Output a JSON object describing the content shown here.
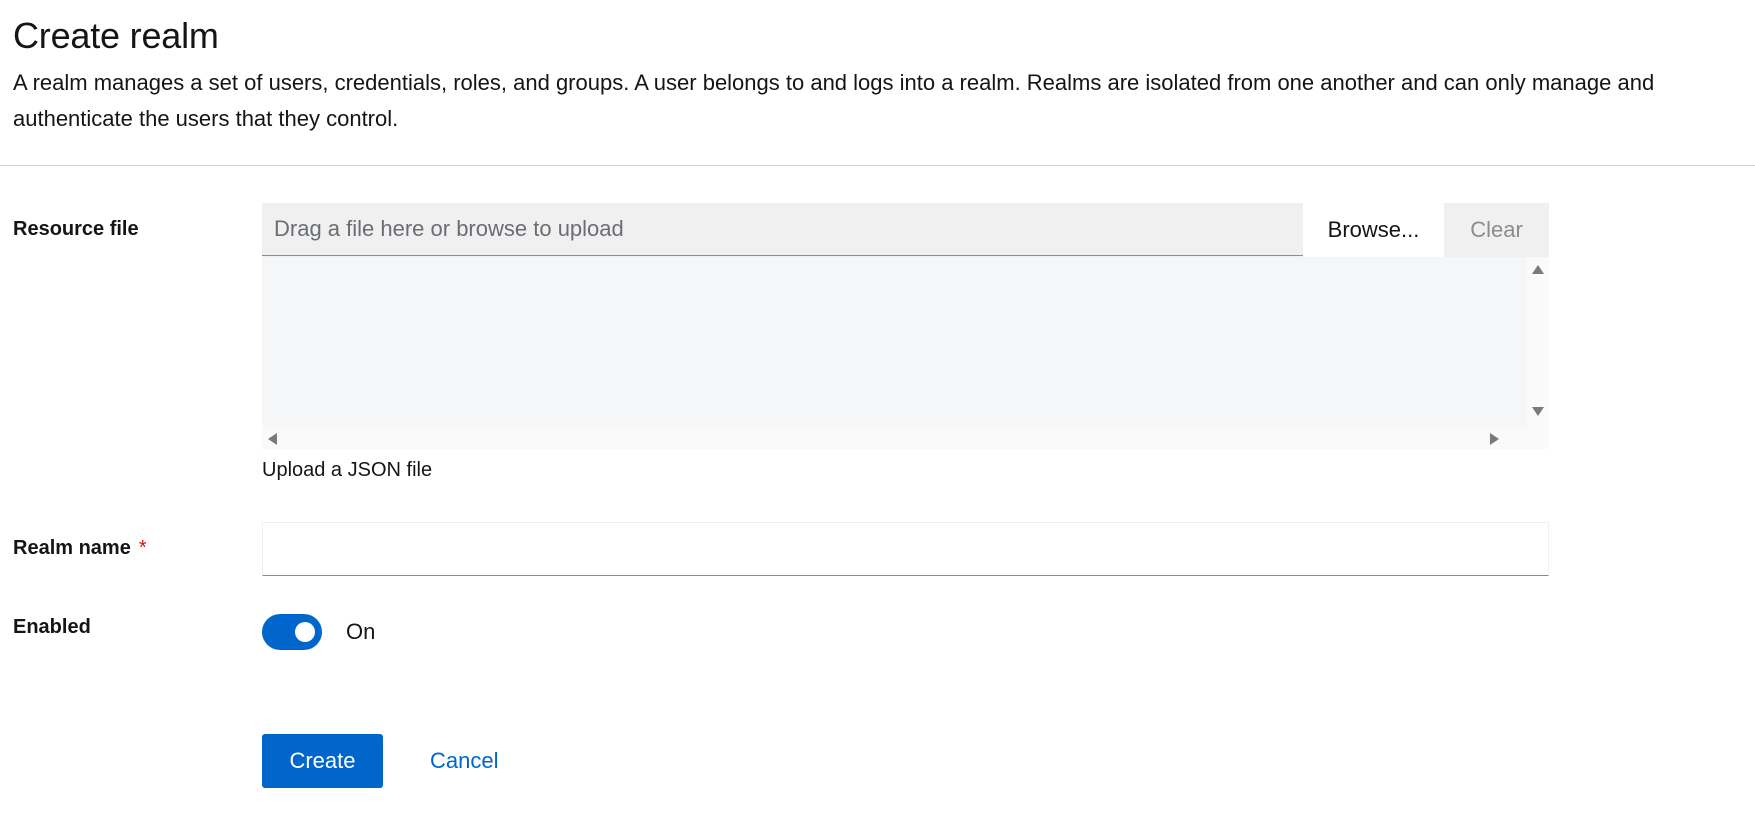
{
  "header": {
    "title": "Create realm",
    "description": "A realm manages a set of users, credentials, roles, and groups. A user belongs to and logs into a realm. Realms are isolated from one another and can only manage and authenticate the users that they control."
  },
  "resource_file": {
    "label": "Resource file",
    "placeholder": "Drag a file here or browse to upload",
    "browse_label": "Browse...",
    "clear_label": "Clear",
    "helper_text": "Upload a JSON file"
  },
  "realm_name": {
    "label": "Realm name",
    "required_marker": "*",
    "value": ""
  },
  "enabled": {
    "label": "Enabled",
    "state_text": "On",
    "checked": true
  },
  "actions": {
    "create_label": "Create",
    "cancel_label": "Cancel"
  },
  "colors": {
    "primary": "#0066cc",
    "required": "#c9190b",
    "text": "#151515"
  }
}
